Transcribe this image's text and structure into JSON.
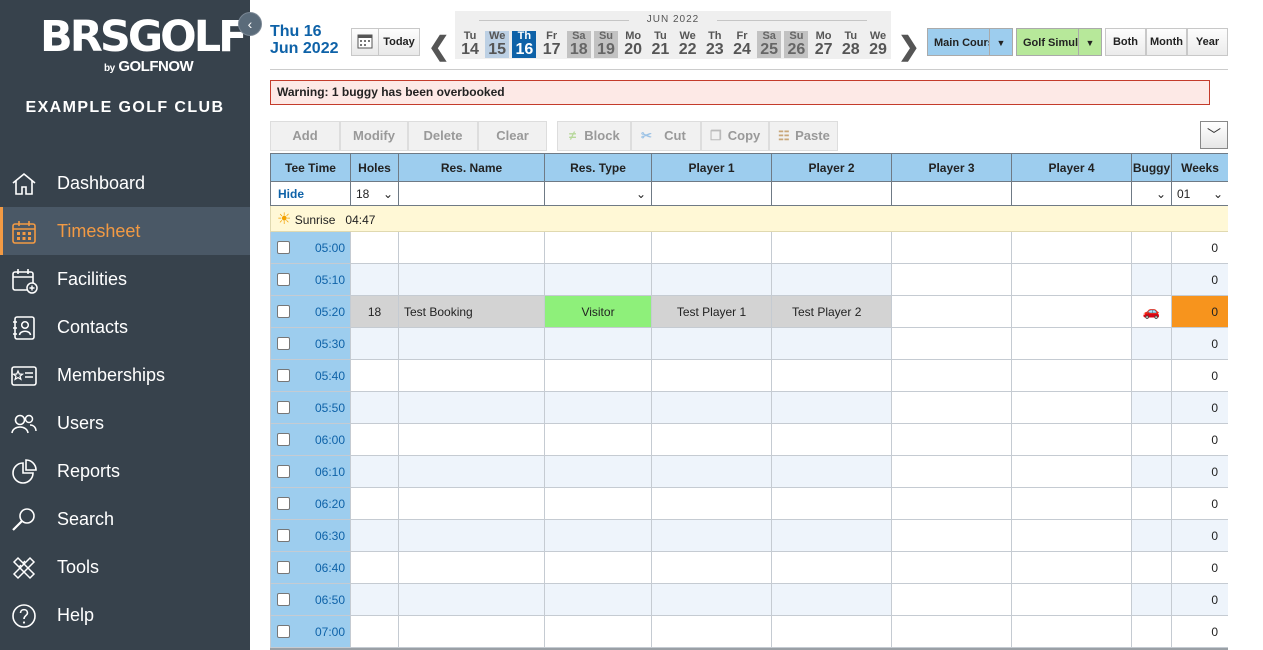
{
  "sidebar": {
    "logo_main": "BRSGOLF",
    "logo_by": "by",
    "logo_sub": "GOLFNOW",
    "club_name": "EXAMPLE GOLF CLUB",
    "items": [
      {
        "label": "Dashboard",
        "icon": "home-icon"
      },
      {
        "label": "Timesheet",
        "icon": "calendar-icon",
        "active": true
      },
      {
        "label": "Facilities",
        "icon": "calendar-plus-icon"
      },
      {
        "label": "Contacts",
        "icon": "contacts-book-icon"
      },
      {
        "label": "Memberships",
        "icon": "membership-card-icon"
      },
      {
        "label": "Users",
        "icon": "users-icon"
      },
      {
        "label": "Reports",
        "icon": "pie-chart-icon"
      },
      {
        "label": "Search",
        "icon": "search-icon"
      },
      {
        "label": "Tools",
        "icon": "tools-icon"
      },
      {
        "label": "Help",
        "icon": "help-icon"
      }
    ]
  },
  "header": {
    "date_line1": "Thu 16",
    "date_line2": "Jun 2022",
    "today_label": "Today",
    "month_label": "JUN 2022",
    "days": [
      {
        "name": "Tu",
        "num": "14",
        "kind": "normal"
      },
      {
        "name": "We",
        "num": "15",
        "kind": "past"
      },
      {
        "name": "Th",
        "num": "16",
        "kind": "today"
      },
      {
        "name": "Fr",
        "num": "17",
        "kind": "normal"
      },
      {
        "name": "Sa",
        "num": "18",
        "kind": "weekend"
      },
      {
        "name": "Su",
        "num": "19",
        "kind": "weekend"
      },
      {
        "name": "Mo",
        "num": "20",
        "kind": "normal"
      },
      {
        "name": "Tu",
        "num": "21",
        "kind": "normal"
      },
      {
        "name": "We",
        "num": "22",
        "kind": "normal"
      },
      {
        "name": "Th",
        "num": "23",
        "kind": "normal"
      },
      {
        "name": "Fr",
        "num": "24",
        "kind": "normal"
      },
      {
        "name": "Sa",
        "num": "25",
        "kind": "weekend"
      },
      {
        "name": "Su",
        "num": "26",
        "kind": "weekend"
      },
      {
        "name": "Mo",
        "num": "27",
        "kind": "normal"
      },
      {
        "name": "Tu",
        "num": "28",
        "kind": "normal"
      },
      {
        "name": "We",
        "num": "29",
        "kind": "normal"
      }
    ],
    "course1_label": "Main Cours",
    "course2_label": "Golf Simul",
    "view_both": "Both",
    "view_month": "Month",
    "view_year": "Year",
    "colors": {
      "course1": "#9dcdee",
      "course2": "#b7e89a",
      "today": "#0e62a8",
      "accent": "#f29a44"
    }
  },
  "warning": "Warning: 1 buggy has been overbooked",
  "actions": {
    "add": "Add",
    "modify": "Modify",
    "delete": "Delete",
    "clear": "Clear",
    "block": "Block",
    "cut": "Cut",
    "copy": "Copy",
    "paste": "Paste"
  },
  "table": {
    "headers": [
      "Tee Time",
      "Holes",
      "Res. Name",
      "Res. Type",
      "Player 1",
      "Player 2",
      "Player 3",
      "Player 4",
      "Buggy",
      "Weeks"
    ],
    "filter": {
      "hide": "Hide",
      "holes": "18",
      "weeks": "01"
    },
    "sunrise_label": "Sunrise",
    "sunrise_time": "04:47",
    "rows": [
      {
        "time": "05:00",
        "holes": "",
        "name": "",
        "type": "",
        "p1": "",
        "p2": "",
        "p3": "",
        "p4": "",
        "buggy": false,
        "weeks": "0"
      },
      {
        "time": "05:10",
        "holes": "",
        "name": "",
        "type": "",
        "p1": "",
        "p2": "",
        "p3": "",
        "p4": "",
        "buggy": false,
        "weeks": "0"
      },
      {
        "time": "05:20",
        "holes": "18",
        "name": "Test Booking",
        "type": "Visitor",
        "p1": "Test Player 1",
        "p2": "Test Player 2",
        "p3": "",
        "p4": "",
        "buggy": true,
        "weeks": "0",
        "booked": true
      },
      {
        "time": "05:30",
        "holes": "",
        "name": "",
        "type": "",
        "p1": "",
        "p2": "",
        "p3": "",
        "p4": "",
        "buggy": false,
        "weeks": "0"
      },
      {
        "time": "05:40",
        "holes": "",
        "name": "",
        "type": "",
        "p1": "",
        "p2": "",
        "p3": "",
        "p4": "",
        "buggy": false,
        "weeks": "0"
      },
      {
        "time": "05:50",
        "holes": "",
        "name": "",
        "type": "",
        "p1": "",
        "p2": "",
        "p3": "",
        "p4": "",
        "buggy": false,
        "weeks": "0"
      },
      {
        "time": "06:00",
        "holes": "",
        "name": "",
        "type": "",
        "p1": "",
        "p2": "",
        "p3": "",
        "p4": "",
        "buggy": false,
        "weeks": "0"
      },
      {
        "time": "06:10",
        "holes": "",
        "name": "",
        "type": "",
        "p1": "",
        "p2": "",
        "p3": "",
        "p4": "",
        "buggy": false,
        "weeks": "0"
      },
      {
        "time": "06:20",
        "holes": "",
        "name": "",
        "type": "",
        "p1": "",
        "p2": "",
        "p3": "",
        "p4": "",
        "buggy": false,
        "weeks": "0"
      },
      {
        "time": "06:30",
        "holes": "",
        "name": "",
        "type": "",
        "p1": "",
        "p2": "",
        "p3": "",
        "p4": "",
        "buggy": false,
        "weeks": "0"
      },
      {
        "time": "06:40",
        "holes": "",
        "name": "",
        "type": "",
        "p1": "",
        "p2": "",
        "p3": "",
        "p4": "",
        "buggy": false,
        "weeks": "0"
      },
      {
        "time": "06:50",
        "holes": "",
        "name": "",
        "type": "",
        "p1": "",
        "p2": "",
        "p3": "",
        "p4": "",
        "buggy": false,
        "weeks": "0"
      },
      {
        "time": "07:00",
        "holes": "",
        "name": "",
        "type": "",
        "p1": "",
        "p2": "",
        "p3": "",
        "p4": "",
        "buggy": false,
        "weeks": "0"
      }
    ],
    "colors": {
      "visitor": "#8ef07a",
      "weeks_flag": "#f7941d"
    }
  }
}
